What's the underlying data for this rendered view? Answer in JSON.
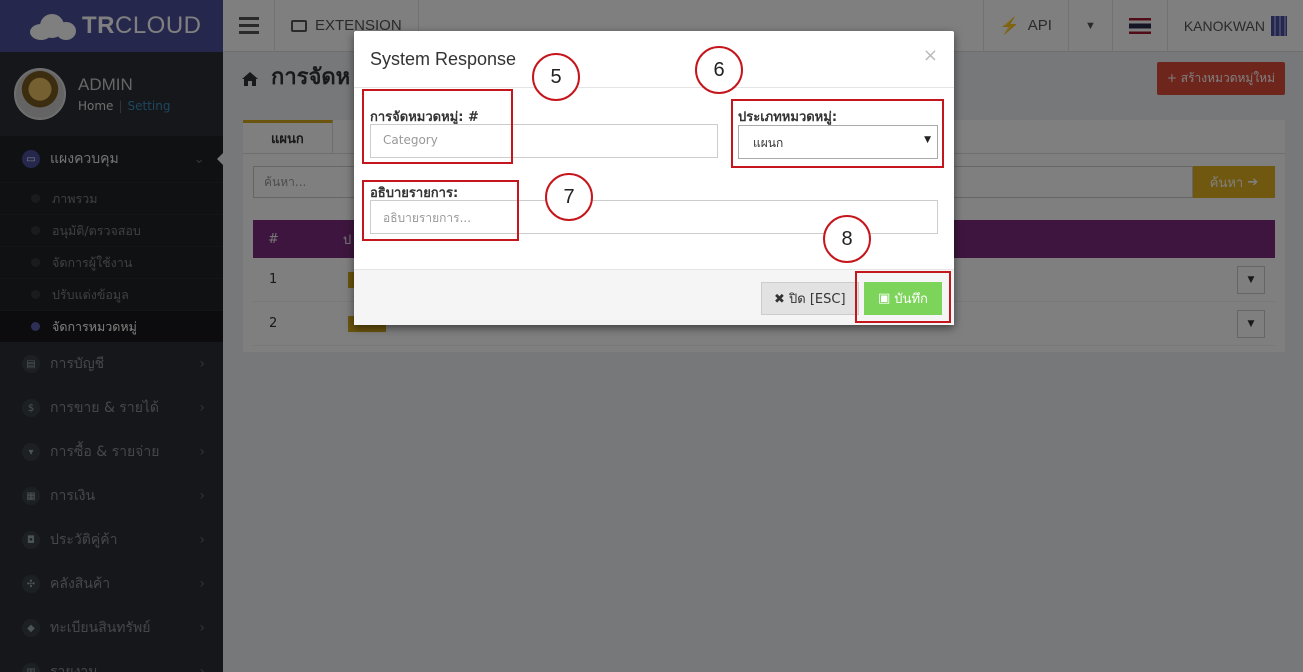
{
  "brand": {
    "name_bold": "TR",
    "name_rest": "CLOUD"
  },
  "user": {
    "name": "ADMIN",
    "home_link": "Home",
    "setting_link": "Setting"
  },
  "sidebar": {
    "active_section": "แผงควบคุม",
    "submenu": [
      "ภาพรวม",
      "อนุมัติ/ตรวจสอบ",
      "จัดการผู้ใช้งาน",
      "ปรับแต่งข้อมูล",
      "จัดการหมวดหมู่"
    ],
    "items": [
      "การบัญชี",
      "การขาย & รายได้",
      "การซื้อ & รายจ่าย",
      "การเงิน",
      "ประวัติคู่ค้า",
      "คลังสินค้า",
      "ทะเบียนสินทรัพย์",
      "รายงาน"
    ]
  },
  "topbar": {
    "extension": "EXTENSION",
    "api": "API",
    "username": "KANOKWAN"
  },
  "page": {
    "title": "การจัดห",
    "create_button": "+ สร้างหมวดหมู่ใหม่",
    "tab": "แผนก",
    "search_placeholder": "ค้นหา...",
    "search_button": "ค้นหา",
    "table": {
      "col_index": "#",
      "col_name": "ป",
      "rows": [
        "1",
        "2"
      ]
    }
  },
  "modal": {
    "title": "System Response",
    "close_symbol": "×",
    "category_label": "การจัดหมวดหมู่: #",
    "category_placeholder": "Category",
    "type_label": "ประเภทหมวดหมู่:",
    "type_value": "แผนก",
    "desc_label": "อธิบายรายการ:",
    "desc_placeholder": "อธิบายรายการ...",
    "close_button": "✖ ปิด [ESC]",
    "save_button": "บันทึก"
  },
  "annotations": [
    "5",
    "6",
    "7",
    "8"
  ],
  "colors": {
    "brand": "#4a4f98",
    "accent_red": "#c4161c",
    "save_green": "#7dd45a",
    "table_header": "#7d2a7d",
    "gold": "#e0b121"
  }
}
